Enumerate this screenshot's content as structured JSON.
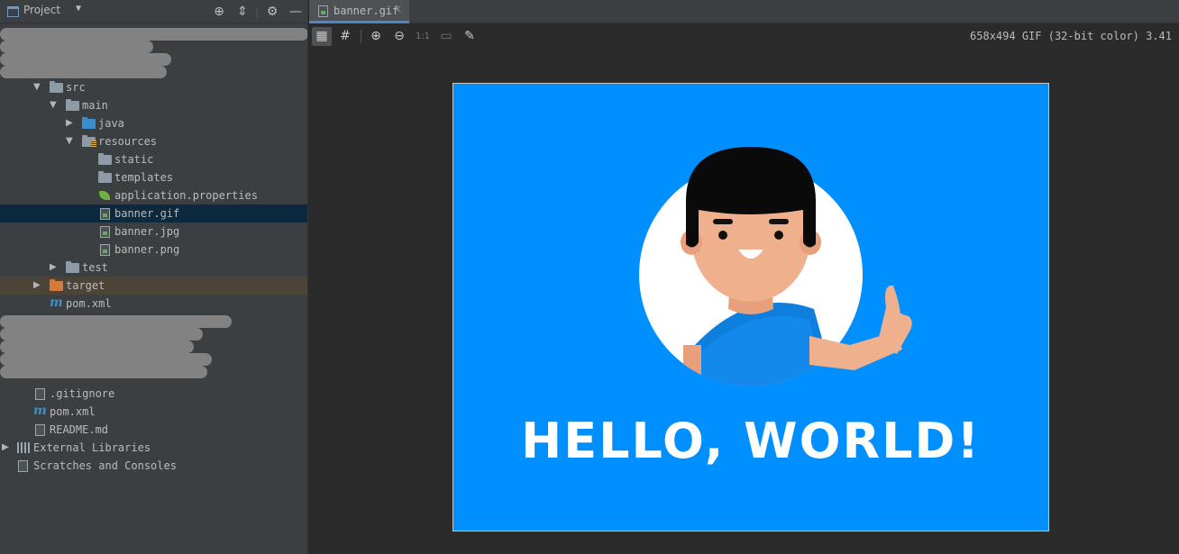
{
  "sidebar": {
    "title": "Project",
    "tree": {
      "src": "src",
      "main": "main",
      "java": "java",
      "resources": "resources",
      "static": "static",
      "templates": "templates",
      "application_properties": "application.properties",
      "banner_gif": "banner.gif",
      "banner_jpg": "banner.jpg",
      "banner_png": "banner.png",
      "test": "test",
      "target": "target",
      "pom_module": "pom.xml",
      "gitignore": ".gitignore",
      "pom_root": "pom.xml",
      "readme": "README.md",
      "external_libraries": "External Libraries",
      "scratches": "Scratches and Consoles"
    }
  },
  "editor": {
    "tab_label": "banner.gif",
    "tab_close": "×",
    "zoom_actual_label": "1:1",
    "image_info": "658x494 GIF (32-bit color) 3.41",
    "image_caption": "HELLO, WORLD!"
  },
  "colors": {
    "gif_background": "#008ffe",
    "selection": "#0d293e",
    "excluded_folder_bg": "#4d4438",
    "accent_tab": "#4a88c7"
  }
}
